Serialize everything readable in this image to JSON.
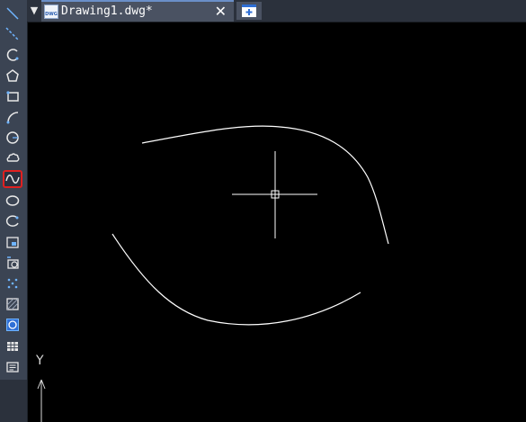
{
  "toolbar": {
    "tools": [
      {
        "name": "line",
        "icon": "line-icon"
      },
      {
        "name": "construction-line",
        "icon": "xline-icon"
      },
      {
        "name": "polyline",
        "icon": "polyline-icon"
      },
      {
        "name": "polygon",
        "icon": "polygon-icon"
      },
      {
        "name": "rectangle",
        "icon": "rectangle-icon"
      },
      {
        "name": "arc",
        "icon": "arc-icon"
      },
      {
        "name": "circle",
        "icon": "circle-icon"
      },
      {
        "name": "revision-cloud",
        "icon": "revcloud-icon"
      },
      {
        "name": "spline",
        "icon": "spline-icon",
        "active": true
      },
      {
        "name": "ellipse",
        "icon": "ellipse-icon"
      },
      {
        "name": "ellipse-arc",
        "icon": "ellipse-arc-icon"
      },
      {
        "name": "insert-block",
        "icon": "insert-block-icon"
      },
      {
        "name": "make-block",
        "icon": "make-block-icon"
      },
      {
        "name": "point",
        "icon": "point-icon"
      },
      {
        "name": "hatch",
        "icon": "hatch-icon"
      },
      {
        "name": "region",
        "icon": "region-icon"
      },
      {
        "name": "table",
        "icon": "table-icon"
      },
      {
        "name": "multiline-text",
        "icon": "mtext-icon"
      }
    ],
    "highlight_color": "#e02020"
  },
  "tabs": {
    "menu_glyph": "▼",
    "active": {
      "title": "Drawing1.dwg*",
      "icon_text": "DWG",
      "close_glyph": "✕"
    },
    "new_tab_icon": "new-tab-icon"
  },
  "canvas": {
    "background": "#000000",
    "stroke_color": "#ffffff",
    "ucs_label": "Y"
  }
}
